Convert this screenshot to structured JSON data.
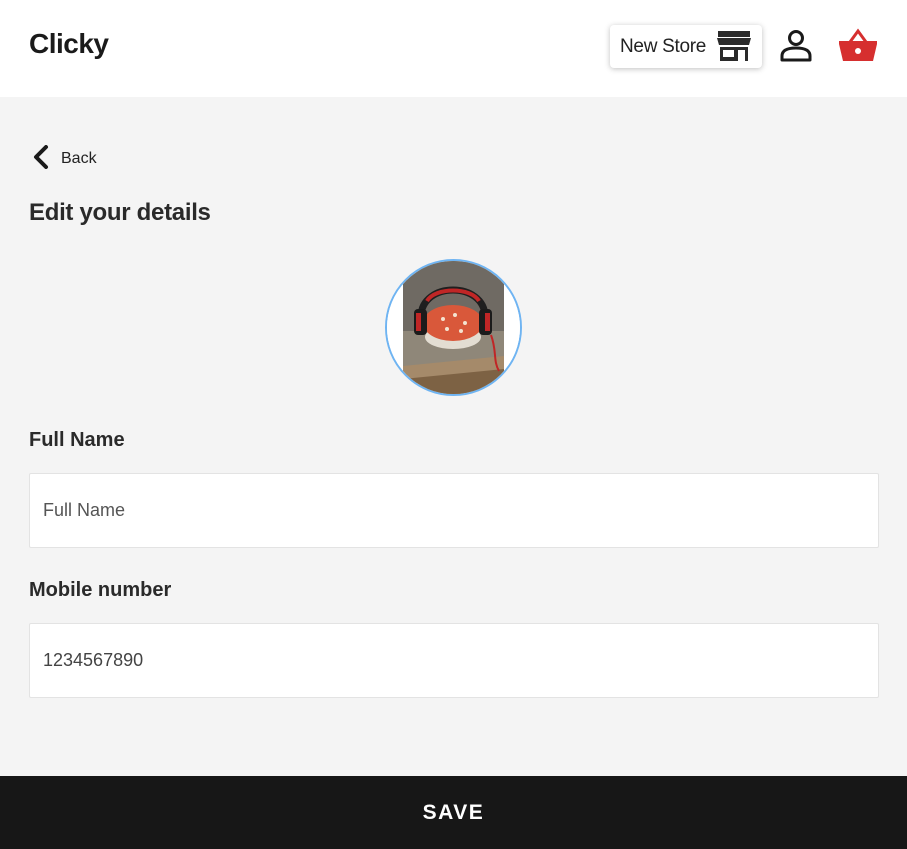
{
  "header": {
    "brand": "Clicky",
    "new_store_label": "New Store",
    "icons": {
      "store": "store-icon",
      "user": "user-icon",
      "basket": "basket-icon"
    },
    "colors": {
      "basket": "#d62f2f"
    }
  },
  "nav": {
    "back_label": "Back"
  },
  "page": {
    "title": "Edit your details"
  },
  "profile": {
    "avatar_ring_color": "#6fb4f2"
  },
  "form": {
    "full_name": {
      "label": "Full Name",
      "placeholder": "Full Name",
      "value": ""
    },
    "mobile": {
      "label": "Mobile number",
      "placeholder": "",
      "value": "1234567890"
    }
  },
  "footer": {
    "save_label": "SAVE"
  }
}
